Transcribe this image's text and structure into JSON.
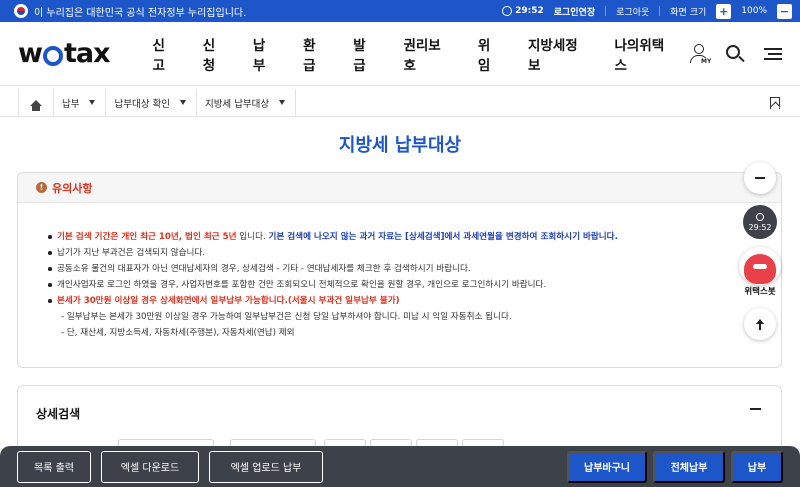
{
  "gov_banner": {
    "text": "이 누리집은 대한민국 공식 전자정부 누리집입니다.",
    "timer": "29:52",
    "extend_label": "로그인연장",
    "logout_label": "로그아웃",
    "zoom_label": "화면 크기",
    "zoom_in": "+",
    "zoom_value": "100%",
    "zoom_out": "−"
  },
  "header": {
    "logo_prefix": "w",
    "logo_suffix": "tax",
    "nav": [
      "신고",
      "신청",
      "납부",
      "환급",
      "발급",
      "권리보호",
      "위임",
      "지방세정보",
      "나의위택스"
    ],
    "my_label": "MY"
  },
  "breadcrumb": {
    "items": [
      "납부",
      "납부대상 확인",
      "지방세 납부대상"
    ]
  },
  "page": {
    "title": "지방세 납부대상"
  },
  "notice": {
    "title": "유의사항",
    "item1_red": "기본 검색 기간은 개인 최근 10년, 법인 최근 5년",
    "item1_mid": " 입니다. ",
    "item1_blue": "기본 검색에 나오지 않는 과거 자료는 [상세검색]에서 과세연월을 변경하여 조회하시기 바랍니다.",
    "item2": "납기가 지난 부과건은 검색되지 않습니다.",
    "item3": "공동소유 물건의 대표자가 아닌 연대납세자의 경우, 상세검색 - 기타 - 연대납세자를 체크한 후 검색하시기 바랍니다.",
    "item4": "개인사업자로 로그인 하였을 경우, 사업자번호를 포함한 건만 조회되오니 전체적으로 확인을 원할 경우, 개인으로 로그인하시기 바랍니다.",
    "item5_red": "본세가 30만원 이상일 경우 상세화면에서 일부납부 가능합니다.(서울시 부과건 일부납부 불가)",
    "item5_sub1": "- 일부납부는 본세가 30만원 이상일 경우 가능하여 일부납부건은 신청 당일 납부하셔야 합니다. 미납 시 익일 자동취소 됩니다.",
    "item5_sub2": "- 단, 재산세, 지방소득세, 자동차세(주행분), 자동차세(연납) 제외"
  },
  "detail_search": {
    "title": "상세검색"
  },
  "actions": {
    "print": "목록 출력",
    "excel_download": "엑셀 다운로드",
    "excel_upload": "엑셀 업로드 납부",
    "cart": "납부바구니",
    "pay_all": "전체납부",
    "pay": "납부"
  },
  "floating": {
    "timer": "29:52",
    "chatbot_label": "위택스봇"
  },
  "colors": {
    "brand_blue": "#1d56c9",
    "warning_red": "#e0301e",
    "action_bar": "#3c414a"
  }
}
